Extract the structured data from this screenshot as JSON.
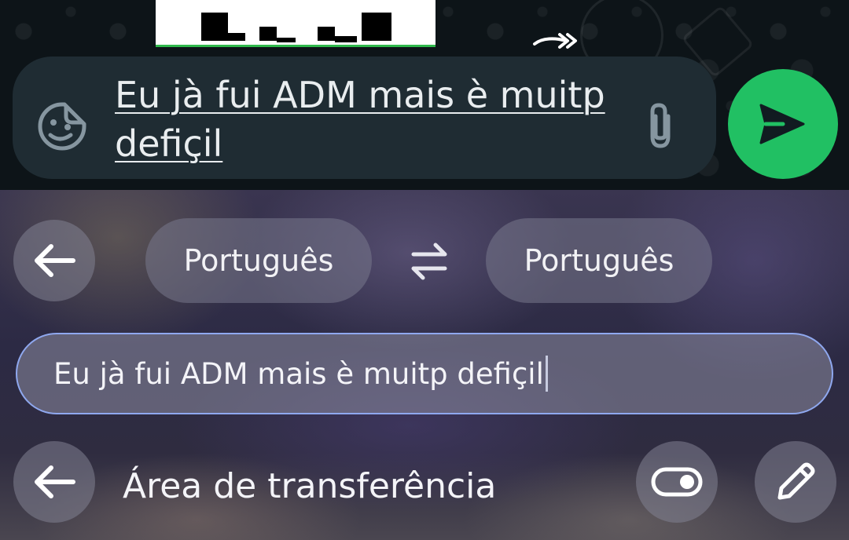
{
  "chat": {
    "message_input_value": "Eu jà fui ADM mais è muitp defiçil",
    "emoji_icon": "sticker-icon",
    "attach_icon": "paperclip-icon",
    "send_icon": "send-icon",
    "forward_icon": "forward-icon"
  },
  "keyboard": {
    "translator": {
      "back_icon": "arrow-left-icon",
      "source_language": "Português",
      "swap_icon": "swap-arrows-icon",
      "target_language": "Português",
      "input_value": "Eu jà fui ADM mais è muitp defiçil"
    },
    "clipboard": {
      "back_icon": "arrow-left-icon",
      "title": "Área de transferência",
      "toggle_icon": "toggle-icon",
      "edit_icon": "pencil-icon"
    }
  },
  "colors": {
    "send_button": "#21c063",
    "input_bar": "#1f2c33",
    "input_focus_border": "#8fa8ef"
  }
}
